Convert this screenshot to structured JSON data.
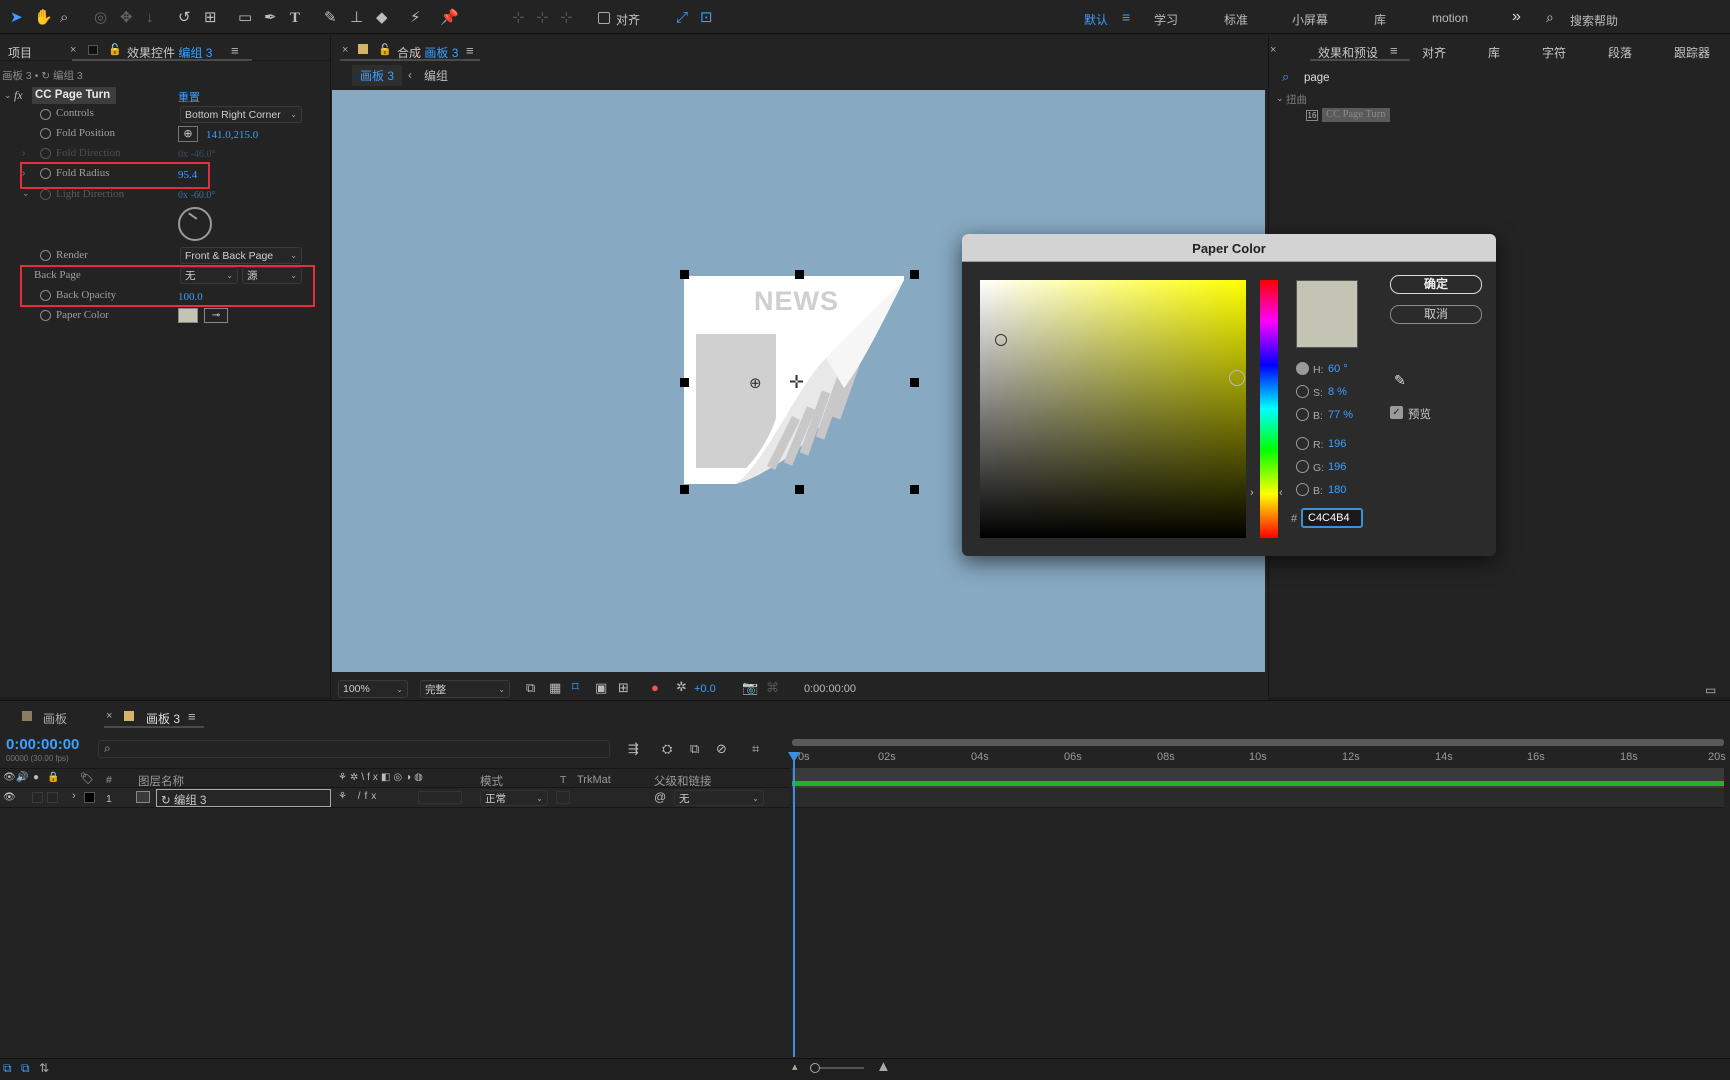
{
  "toolbar": {
    "align_label": "对齐",
    "workspaces": [
      "默认",
      "学习",
      "标准",
      "小屏幕",
      "库",
      "motion"
    ],
    "more": "»",
    "search_placeholder": "搜索帮助"
  },
  "left_panel": {
    "project_tab": "项目",
    "effects_tab_prefix": "效果控件",
    "effects_tab_layer": "编组 3",
    "breadcrumb": "画板 3 • ↻ 编组 3",
    "effect": {
      "name": "CC Page Turn",
      "reset": "重置",
      "props": [
        {
          "label": "Controls",
          "value": "Bottom Right Corner"
        },
        {
          "label": "Fold Position",
          "value": "141.0,215.0"
        },
        {
          "label": "Fold Direction",
          "value": "0x -46.0°"
        },
        {
          "label": "Fold Radius",
          "value": "95.4"
        },
        {
          "label": "Light Direction",
          "value": "0x -60.0°"
        },
        {
          "label": "Render",
          "value": "Front & Back Page"
        },
        {
          "label": "Back Page",
          "value": "无",
          "value2": "源"
        },
        {
          "label": "Back Opacity",
          "value": "100.0"
        },
        {
          "label": "Paper Color",
          "value": "#C4C4B4"
        }
      ]
    }
  },
  "comp": {
    "tab_prefix": "合成",
    "tab_name": "画板 3",
    "breadcrumb": [
      "画板 3",
      "编组"
    ],
    "news_text": "NEWS",
    "bg_color": "#87a9c2",
    "zoom": "100%",
    "quality": "完整",
    "exposure": "+0.0",
    "timecode": "0:00:00:00"
  },
  "right_panel": {
    "tabs": [
      "效果和预设",
      "对齐",
      "库",
      "字符",
      "段落",
      "跟踪器"
    ],
    "search_value": "page",
    "category": "扭曲",
    "result": "CC Page Turn"
  },
  "color_dialog": {
    "title": "Paper Color",
    "ok": "确定",
    "cancel": "取消",
    "h_label": "H:",
    "h_value": "60 °",
    "s_label": "S:",
    "s_value": "8 %",
    "b_label": "B:",
    "b_value": "77 %",
    "r_label": "R:",
    "r_value": "196",
    "g_label": "G:",
    "g_value": "196",
    "bb_label": "B:",
    "bb_value": "180",
    "hash": "#",
    "hex": "C4C4B4",
    "preview_label": "预览",
    "swatch_color": "#c4c4b4",
    "preview_checked": true
  },
  "timeline": {
    "tab1": "画板",
    "tab2": "画板 3",
    "timecode": "0:00:00:00",
    "fps": "00000 (30.00 fps)",
    "col_num": "#",
    "col_layer": "图层名称",
    "col_mode": "模式",
    "col_t": "T",
    "col_trkmat": "TrkMat",
    "col_parent": "父级和链接",
    "layer": {
      "num": "1",
      "name": "编组 3",
      "mode": "正常",
      "parent": "无"
    },
    "ticks": [
      "0s",
      "02s",
      "04s",
      "06s",
      "08s",
      "10s",
      "12s",
      "14s",
      "16s",
      "18s",
      "20s"
    ]
  }
}
